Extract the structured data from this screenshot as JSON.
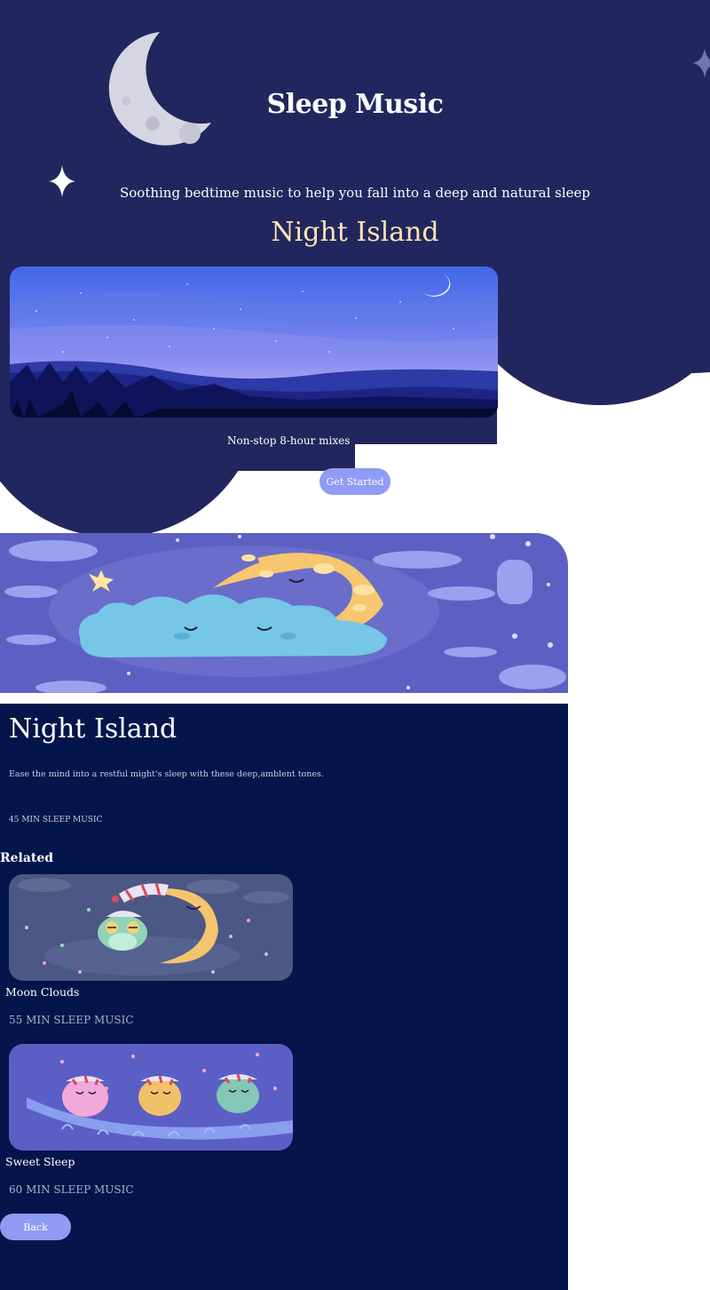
{
  "header": {
    "title": "Sleep Music",
    "subtitle": "Soothing bedtime music to help you fall into a deep and natural sleep",
    "icons": [
      "moon-icon",
      "sparkle-star-icon"
    ]
  },
  "featured": {
    "title": "Night Island",
    "caption": "Non-stop 8-hour mixes",
    "button_label": "Get Started"
  },
  "detail": {
    "title": "Night Island",
    "description": "Ease the mind into a restful might's sleep with these deep,amblent tones.",
    "duration": "45 MIN SLEEP MUSIC"
  },
  "related": {
    "heading": "Related",
    "items": [
      {
        "name": "Moon Clouds",
        "duration": "55 MIN SLEEP MUSIC"
      },
      {
        "name": "Sweet Sleep",
        "duration": "60 MIN SLEEP MUSIC"
      }
    ]
  },
  "back_label": "Back",
  "colors": {
    "header_bg": "#21275e",
    "detail_bg": "#03154a",
    "accent_button": "#8f9bf4",
    "feature_title": "#ffe3b0"
  }
}
